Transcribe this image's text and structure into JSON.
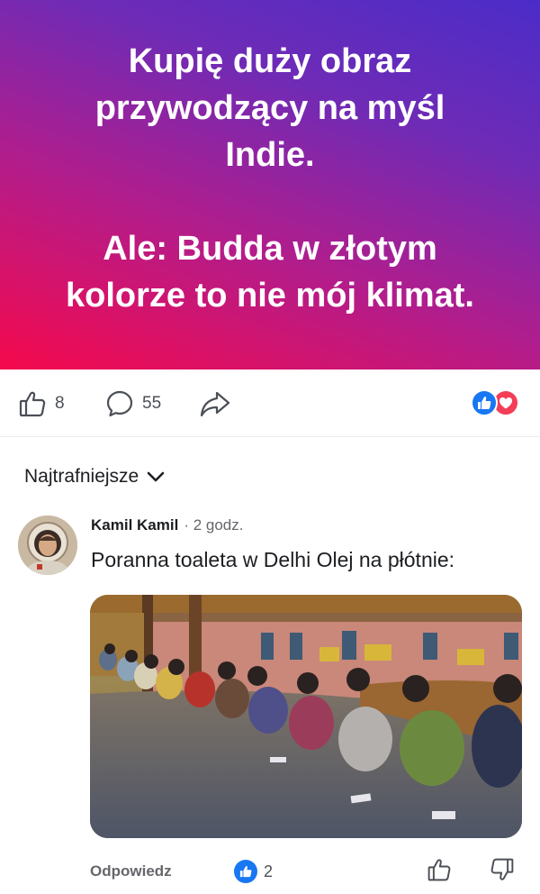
{
  "post": {
    "banner_text": "Kupię duży obraz\nprzywodzący na myśl\nIndie.\n\nAle: Budda w złotym\nkolorze to nie mój klimat.",
    "banner_gradient": [
      "#f5094c",
      "#b21d8c",
      "#6f2bb6",
      "#4b2cc8"
    ]
  },
  "actions": {
    "like_count": "8",
    "comment_count": "55",
    "reactions": [
      "like",
      "love"
    ]
  },
  "comments_section": {
    "sort_label": "Najtrafniejsze"
  },
  "comment": {
    "author": "Kamil Kamil",
    "time": "· 2 godz.",
    "text": "Poranna toaleta w Delhi Olej na płótnie:",
    "reply_label": "Odpowiedz",
    "reaction_count": "2"
  },
  "colors": {
    "accent_blue": "#1877f2",
    "love_red": "#f33e58",
    "text_primary": "#1c1e21",
    "text_secondary": "#65676b"
  },
  "icons": {
    "like": "thumbs-up-outline",
    "comment": "speech-bubble-outline",
    "share": "share-arrow-outline",
    "sort_toggle": "chevron-down",
    "vote_up": "thumbs-up-outline",
    "vote_down": "thumbs-down-outline"
  }
}
